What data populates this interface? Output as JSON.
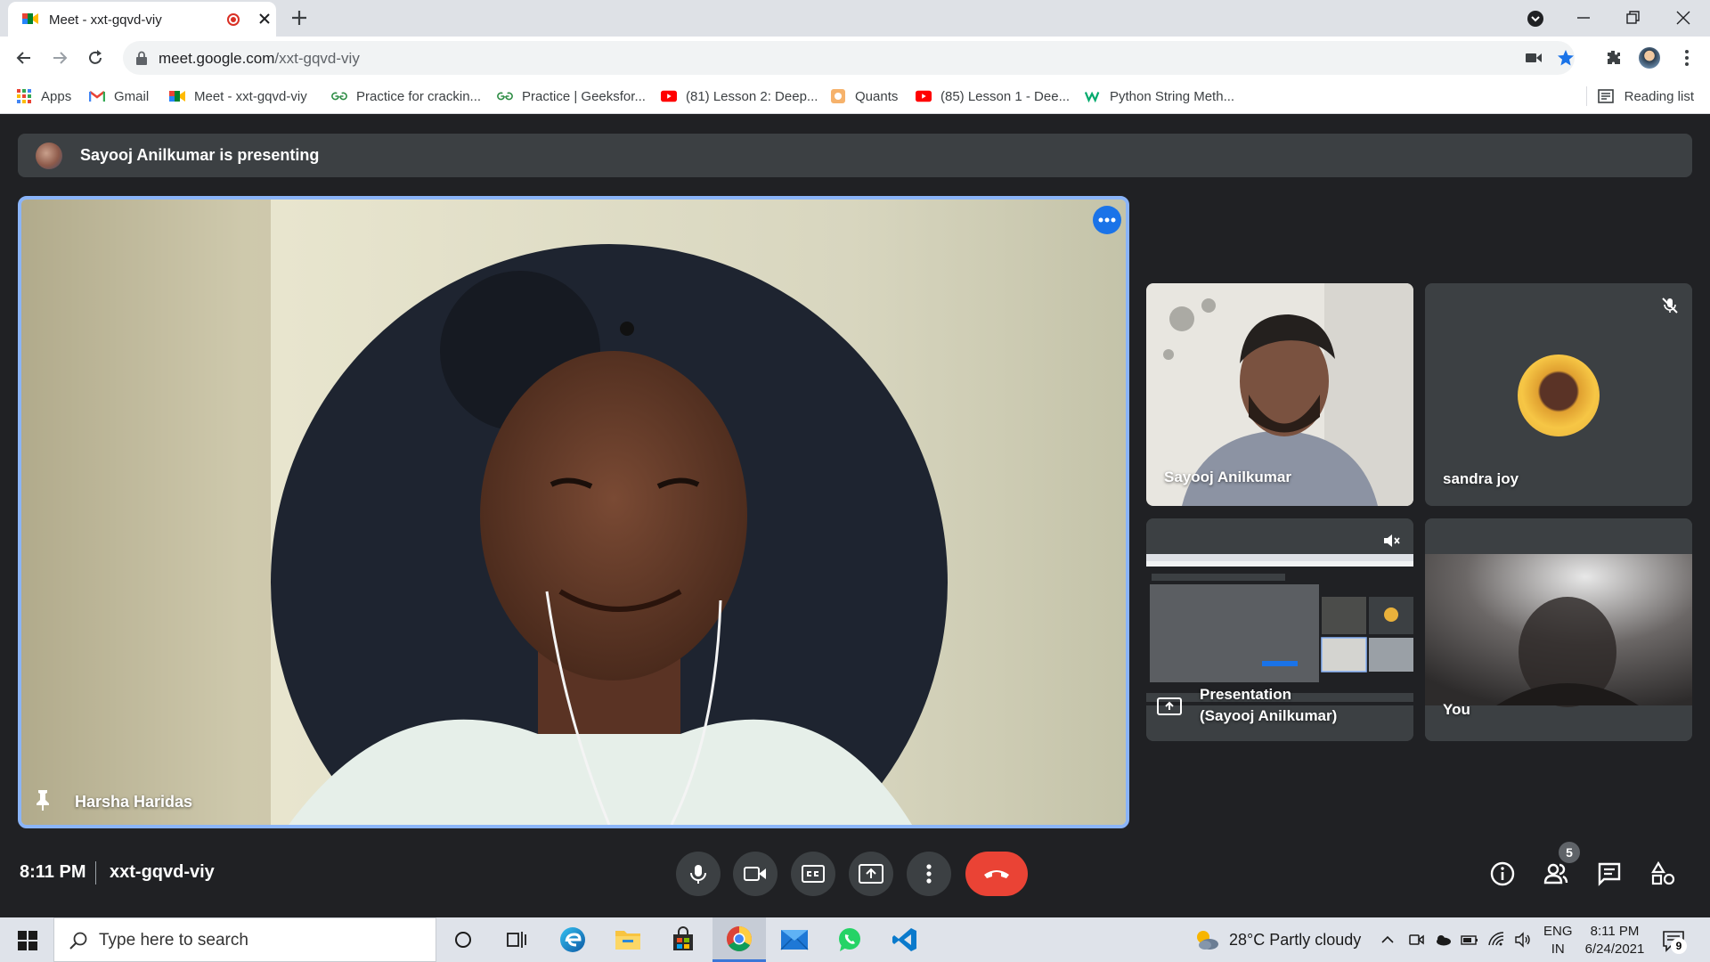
{
  "browser": {
    "tab_title": "Meet - xxt-gqvd-viy",
    "url_host": "meet.google.com",
    "url_path": "/xxt-gqvd-viy",
    "bookmarks": [
      {
        "label": "Apps",
        "icon": "apps-grid-icon"
      },
      {
        "label": "Gmail",
        "icon": "gmail-icon"
      },
      {
        "label": "Meet - xxt-gqvd-viy",
        "icon": "meet-icon"
      },
      {
        "label": "Practice for crackin...",
        "icon": "geeksforgeeks-icon"
      },
      {
        "label": "Practice | Geeksfor...",
        "icon": "geeksforgeeks-icon"
      },
      {
        "label": "(81) Lesson 2: Deep...",
        "icon": "youtube-icon"
      },
      {
        "label": "Quants",
        "icon": "quants-icon"
      },
      {
        "label": "(85) Lesson 1 - Dee...",
        "icon": "youtube-icon"
      },
      {
        "label": "Python String Meth...",
        "icon": "w3schools-icon"
      }
    ],
    "reading_list": "Reading list"
  },
  "meet": {
    "presenting_banner": "Sayooj Anilkumar is presenting",
    "main_participant": "Harsha Haridas",
    "tiles": {
      "sayooj": "Sayooj Anilkumar",
      "sandra": "sandra joy",
      "presentation_line1": "Presentation",
      "presentation_line2": "(Sayooj Anilkumar)",
      "you": "You"
    },
    "time": "8:11 PM",
    "meeting_code": "xxt-gqvd-viy",
    "people_count": "5"
  },
  "colors": {
    "accent": "#8ab4f8",
    "meet_blue": "#1a73e8",
    "end_call_red": "#ea4335",
    "meet_bg": "#202124",
    "tile_bg": "#3c4043"
  },
  "taskbar": {
    "search_placeholder": "Type here to search",
    "weather": "28°C  Partly cloudy",
    "lang_line1": "ENG",
    "lang_line2": "IN",
    "time": "8:11 PM",
    "date": "6/24/2021",
    "notification_count": "9"
  }
}
